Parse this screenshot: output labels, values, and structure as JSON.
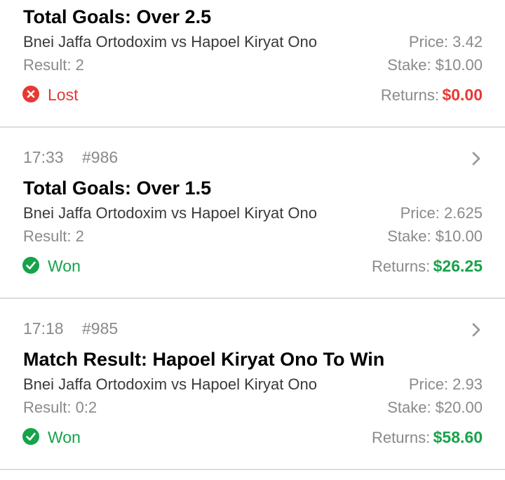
{
  "bets": [
    {
      "time": "",
      "id": "",
      "market": "Total Goals: Over 2.5",
      "match": "Bnei Jaffa Ortodoxim vs Hapoel Kiryat Ono",
      "result": "Result: 2",
      "price": "Price: 3.42",
      "stake": "Stake: $10.00",
      "status": "Lost",
      "returns_label": "Returns:",
      "returns_value": "$0.00",
      "status_color": "#e53935"
    },
    {
      "time": "17:33",
      "id": "#986",
      "market": "Total Goals: Over 1.5",
      "match": "Bnei Jaffa Ortodoxim vs Hapoel Kiryat Ono",
      "result": "Result: 2",
      "price": "Price: 2.625",
      "stake": "Stake: $10.00",
      "status": "Won",
      "returns_label": "Returns:",
      "returns_value": "$26.25",
      "status_color": "#16a34a"
    },
    {
      "time": "17:18",
      "id": "#985",
      "market": "Match Result: Hapoel Kiryat Ono To Win",
      "match": "Bnei Jaffa Ortodoxim vs Hapoel Kiryat Ono",
      "result": "Result: 0:2",
      "price": "Price: 2.93",
      "stake": "Stake: $20.00",
      "status": "Won",
      "returns_label": "Returns:",
      "returns_value": "$58.60",
      "status_color": "#16a34a"
    }
  ],
  "icons": {
    "lost": "x-circle-icon",
    "won": "check-circle-icon",
    "chevron": "chevron-right-icon"
  }
}
